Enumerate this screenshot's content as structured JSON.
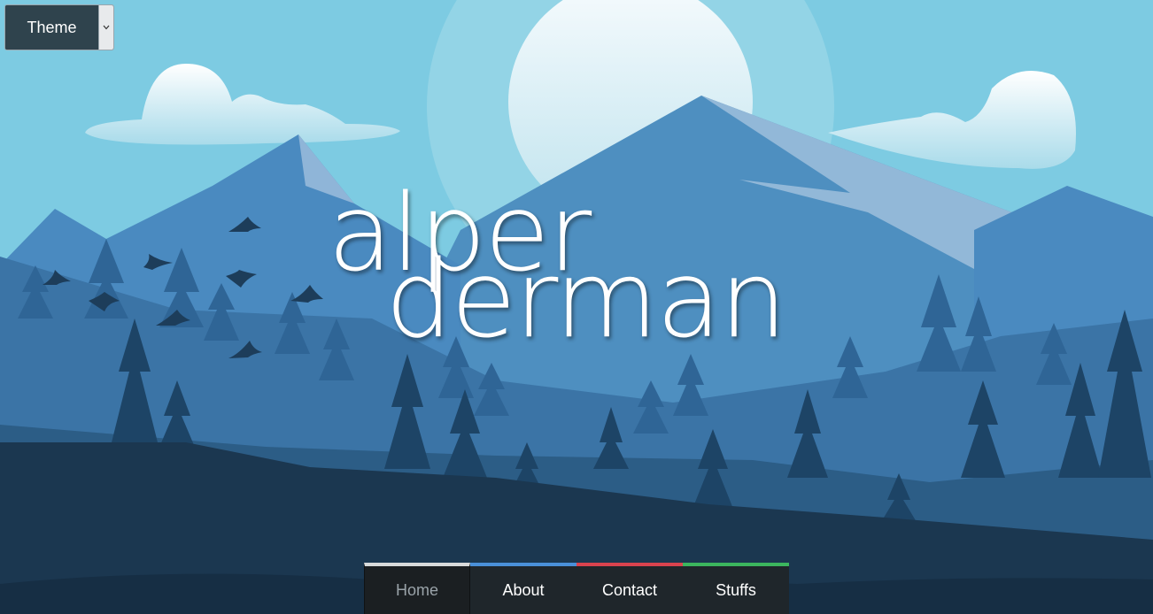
{
  "theme_select": {
    "label": "Theme",
    "arrow_icon": "chevron-down-icon"
  },
  "logo": {
    "line1": "alper",
    "line2": "derman"
  },
  "nav": {
    "items": [
      {
        "label": "Home",
        "accent": "#d8dadb",
        "active": true
      },
      {
        "label": "About",
        "accent": "#4a90d9",
        "active": false
      },
      {
        "label": "Contact",
        "accent": "#d9434e",
        "active": false
      },
      {
        "label": "Stuffs",
        "accent": "#3cb55e",
        "active": false
      }
    ]
  },
  "colors": {
    "sky": "#7dcbe2",
    "far_mountain": "#4e8fc0",
    "near_forest": "#1c3a52",
    "nav_bg": "#1f262b"
  }
}
